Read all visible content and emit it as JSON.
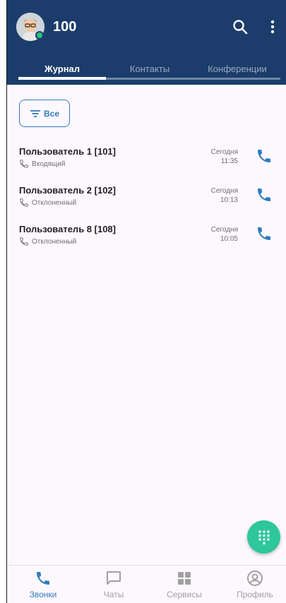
{
  "header": {
    "extension": "100",
    "colors": {
      "background": "#1c3d6b",
      "status_online": "#2ec27e"
    }
  },
  "tabs": [
    {
      "label": "Журнал",
      "active": true
    },
    {
      "label": "Контакты",
      "active": false
    },
    {
      "label": "Конференции",
      "active": false
    }
  ],
  "filter": {
    "label": "Все"
  },
  "calls": [
    {
      "name": "Пользователь 1 [101]",
      "type": "Входящий",
      "day": "Сегодня",
      "time": "11:35"
    },
    {
      "name": "Пользователь 2 [102]",
      "type": "Отклоненный",
      "day": "Сегодня",
      "time": "10:13"
    },
    {
      "name": "Пользователь 8 [108]",
      "type": "Отклоненный",
      "day": "Сегодня",
      "time": "10:05"
    }
  ],
  "bottom_nav": [
    {
      "label": "Звонки",
      "icon": "phone-icon",
      "active": true
    },
    {
      "label": "Чаты",
      "icon": "chat-icon",
      "active": false
    },
    {
      "label": "Сервисы",
      "icon": "grid-icon",
      "active": false
    },
    {
      "label": "Профиль",
      "icon": "profile-icon",
      "active": false
    }
  ],
  "colors": {
    "accent": "#2f7bbf",
    "fab": "#2dc79a"
  }
}
